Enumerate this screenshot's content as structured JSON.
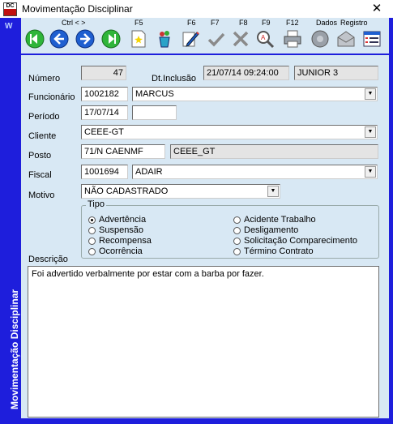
{
  "window": {
    "title": "Movimentação Disciplinar",
    "side_title": "Movimentação Disciplinar",
    "side_mark": "W",
    "app_icon_text": "DC",
    "close_glyph": "✕"
  },
  "toolbar": {
    "fkeys": {
      "ctrl": "Ctrl < >",
      "f5": "F5",
      "f6": "F6",
      "f7": "F7",
      "f8": "F8",
      "f9": "F9",
      "f12": "F12",
      "dados": "Dados",
      "registro": "Registro"
    },
    "icons": [
      "first-icon",
      "previous-icon",
      "next-icon",
      "last-icon",
      "new-icon",
      "fill-icon",
      "edit-icon",
      "confirm-icon",
      "cancel-icon",
      "search-icon",
      "print-icon",
      "data-icon",
      "mail-icon",
      "register-icon"
    ]
  },
  "form": {
    "numero_label": "Número",
    "numero_value": "47",
    "dtinclusao_label": "Dt.Inclusão",
    "dtinclusao_value": "21/07/14 09:24:00",
    "user_value": "JUNIOR 3",
    "funcionario_label": "Funcionário",
    "funcionario_code": "1002182",
    "funcionario_name": "MARCUS",
    "periodo_label": "Período",
    "periodo_start": "17/07/14",
    "periodo_end": "",
    "cliente_label": "Cliente",
    "cliente_value": "CEEE-GT",
    "posto_label": "Posto",
    "posto_code": "71/N CAENMF",
    "posto_name": "CEEE_GT",
    "fiscal_label": "Fiscal",
    "fiscal_code": "1001694",
    "fiscal_name": "ADAIR",
    "motivo_label": "Motivo",
    "motivo_value": "NÃO CADASTRADO",
    "tipo_label": "Tipo",
    "tipo_left": [
      "Advertência",
      "Suspensão",
      "Recompensa",
      "Ocorrência"
    ],
    "tipo_right": [
      "Acidente Trabalho",
      "Desligamento",
      "Solicitação Comparecimento",
      "Término Contrato"
    ],
    "tipo_selected": "Advertência",
    "descricao_label": "Descrição",
    "descricao_value": "Foi advertido verbalmente por estar com a barba por fazer."
  },
  "colors": {
    "frame": "#1e1edc",
    "panel": "#d8e8f4",
    "nav_green": "#2fb53a",
    "nav_blue": "#1f5fd0"
  }
}
